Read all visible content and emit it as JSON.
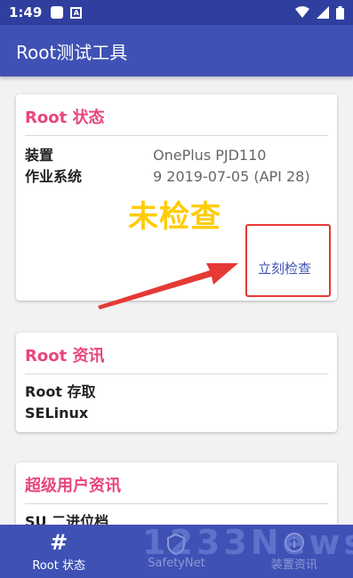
{
  "status_bar": {
    "time": "1:49",
    "notification_icon_a": "A"
  },
  "app_bar": {
    "title": "Root测试工具"
  },
  "root_status_card": {
    "title": "Root 状态",
    "rows": [
      {
        "label": "装置",
        "value": "OnePlus PJD110"
      },
      {
        "label": "作业系统",
        "value": "9 2019-07-05 (API 28)"
      }
    ],
    "annotation_text": "未检查",
    "check_button_label": "立刻检查"
  },
  "root_info_card": {
    "title": "Root 资讯",
    "rows": [
      {
        "label": "Root 存取"
      },
      {
        "label": "SELinux"
      }
    ]
  },
  "superuser_card": {
    "title": "超级用户资讯",
    "rows": [
      {
        "label": "SU 二进位档"
      }
    ]
  },
  "bottom_nav": {
    "items": [
      {
        "icon": "#",
        "label": "Root 状态"
      },
      {
        "icon": "shield-icon",
        "label": "SafetyNet"
      },
      {
        "icon": "info-icon",
        "label": "装置资讯"
      }
    ]
  },
  "watermark": "1233News",
  "colors": {
    "primary": "#3f51b5",
    "primary_dark": "#303f9f",
    "accent": "#e8467c",
    "annotation": "#ffcc00",
    "arrow": "#e53935"
  }
}
